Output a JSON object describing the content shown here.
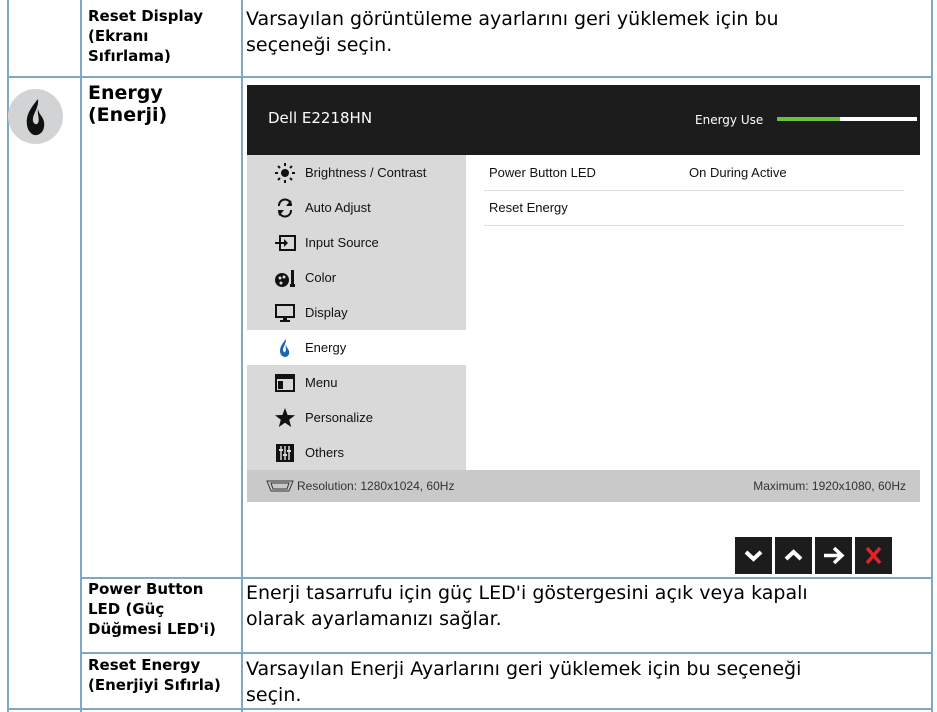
{
  "rows": [
    {
      "term": [
        "Reset Display",
        "(Ekranı",
        "Sıfırlama)"
      ],
      "description": "Varsayılan görüntüleme ayarlarını geri yüklemek için bu seçeneği seçin.",
      "desc_lines": [
        "Varsayılan görüntüleme ayarlarını geri yüklemek için bu",
        "seçeneği seçin."
      ]
    },
    {
      "term": [
        "Energy",
        "(Enerji)"
      ],
      "icon": "energy-flame-icon"
    },
    {
      "term": [
        "Power Button",
        "LED (Güç",
        "Düğmesi LED'i)"
      ],
      "description": "Enerji tasarrufu için güç LED'i göstergesini açık veya kapalı olarak ayarlamanızı sağlar.",
      "desc_lines": [
        "Enerji tasarrufu için güç LED'i göstergesini açık veya kapalı",
        "olarak ayarlamanızı sağlar."
      ]
    },
    {
      "term": [
        "Reset Energy",
        "(Enerjiyi Sıfırla)"
      ],
      "description": "Varsayılan Enerji Ayarlarını geri yüklemek için bu seçeneği seçin.",
      "desc_lines": [
        "Varsayılan Enerji Ayarlarını geri yüklemek için bu seçeneği",
        "seçin."
      ]
    }
  ],
  "osd": {
    "model": "Dell E2218HN",
    "energy_use_label": "Energy Use",
    "energy_use_level": 0.45,
    "energy_color": "#6bc23a",
    "menu": [
      {
        "label": "Brightness / Contrast",
        "icon": "brightness-icon"
      },
      {
        "label": "Auto Adjust",
        "icon": "auto-adjust-icon"
      },
      {
        "label": "Input Source",
        "icon": "input-source-icon"
      },
      {
        "label": "Color",
        "icon": "color-icon"
      },
      {
        "label": "Display",
        "icon": "display-icon"
      },
      {
        "label": "Energy",
        "icon": "energy-icon",
        "active": true
      },
      {
        "label": "Menu",
        "icon": "menu-icon"
      },
      {
        "label": "Personalize",
        "icon": "personalize-star-icon"
      },
      {
        "label": "Others",
        "icon": "others-icon"
      }
    ],
    "panel": [
      {
        "label": "Power Button LED",
        "value": "On During Active"
      },
      {
        "label": "Reset Energy",
        "value": ""
      }
    ],
    "resolution": "Resolution: 1280x1024, 60Hz",
    "maximum": "Maximum: 1920x1080, 60Hz",
    "nav_buttons": [
      "down-icon",
      "up-icon",
      "right-arrow-icon",
      "close-x-icon"
    ]
  }
}
